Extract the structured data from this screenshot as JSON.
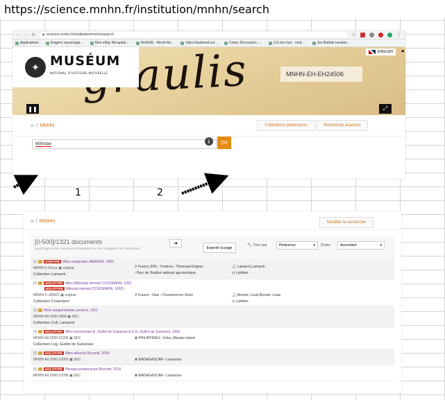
{
  "caption": {
    "url": "https://science.mnhn.fr/institution/mnhn/search"
  },
  "browser": {
    "address": "science.mnhn.fr/institution/mnhn/search",
    "bookmarks": [
      "Applications",
      "Etagere rayonnage...",
      "Mon eBay Récapitul...",
      "WoRMS - World Re...",
      "https://webmail.uni...",
      "Cowry Discussion -...",
      "(13 non lus) - nmic...",
      "Jeu Bubble breaker..."
    ]
  },
  "site": {
    "brand": "MUSÉUM",
    "brand_sub": "NATIONAL D'HISTOIRE NATURELLE",
    "language": "ENGLISH",
    "hero_script": "graulis",
    "specimen_id": "MNHN-EH-EH24506"
  },
  "search_page": {
    "breadcrumb": "MNHN",
    "partner_btn": "Collections partenaires",
    "advanced_btn": "Recherche avancée",
    "query": "Mitridae",
    "ok": "OK"
  },
  "annotations": {
    "one": "1",
    "two": "2"
  },
  "results_page": {
    "breadcrumb": "MNHN",
    "modify_btn": "Modifier la recherche",
    "count": "[0-500]/1321 documents",
    "note": "(seuls figurent les spécimens informatisés et non l'intégralité des collections)",
    "export": "Exporter la page",
    "sort_label": "Trier par",
    "sort_value": "Pertinence",
    "order_label": "Ordre",
    "order_value": "Ascendant",
    "records": [
      {
        "idx": "[1]",
        "badge": "SYNTYPE",
        "taxon": "Mitra marginata",
        "author": "LAMARCK, 1803",
        "id": "MNHN-F-A2xxx",
        "imgnote": "original",
        "coll": "Collection Lamarck",
        "loc": "France (FR) › Yvelines › Thiverval-Grignon",
        "loc2": "› Parc de l'Institut national agronomique",
        "person": "Lamarck,Lamarck",
        "person2": "Lutétien"
      },
      {
        "idx": "[2]",
        "badge": "HOLOTYPE",
        "taxon": "Mitra (Mitreola) bonneti",
        "author": "COSSMANN, 1902",
        "badge2": "HOLOTYPE",
        "taxon2": "Mitreola bonneti",
        "author2": "(COSSMANN, 1902)",
        "id": "MNHN-F-J05922",
        "imgnote": "original",
        "coll": "Collection Cossmann",
        "loc": "France › Oise › Chaumont-en-Vexin",
        "person": "Bonnet, Louis,Bonnet, Louis",
        "person2": "Lutétien"
      },
      {
        "idx": "[3]",
        "badge": "",
        "taxon": "Mitra sanguinolenta",
        "author": "Lamarck, 1811",
        "id": "MNHN-IM-2000-2668",
        "imgnote": "SEC",
        "coll": "Collection Coll. Lamarck"
      },
      {
        "idx": "[4]",
        "badge": "HOLOTYPE",
        "taxon": "Mitra hanshumeri",
        "author": "E. Guillot de Suduiraut & E.G. Guillot de Suduiraut, 2009",
        "id": "MNHN-IM-2000-22206",
        "imgnote": "SEC",
        "coll": "Collection Leg. Guillot de Suduiraut",
        "loc": "PHILIPPINES › Cebu, Mactan Island"
      },
      {
        "idx": "[5]",
        "badge": "HOLOTYPE",
        "taxon": "Mitra alborufa",
        "author": "Bozzetti, 2009",
        "id": "MNHN-IM-2000-22903",
        "imgnote": "SEC",
        "loc": "MADAGASCAR › Lavanono"
      },
      {
        "idx": "[6]",
        "badge": "HOLOTYPE",
        "taxon": "Pterygia jeanjacquesi",
        "author": "Bozzetti, 2010",
        "id": "MNHN-IM-2000-23786",
        "imgnote": "SEC",
        "loc": "MADAGASCAR › Lavanono"
      }
    ]
  }
}
